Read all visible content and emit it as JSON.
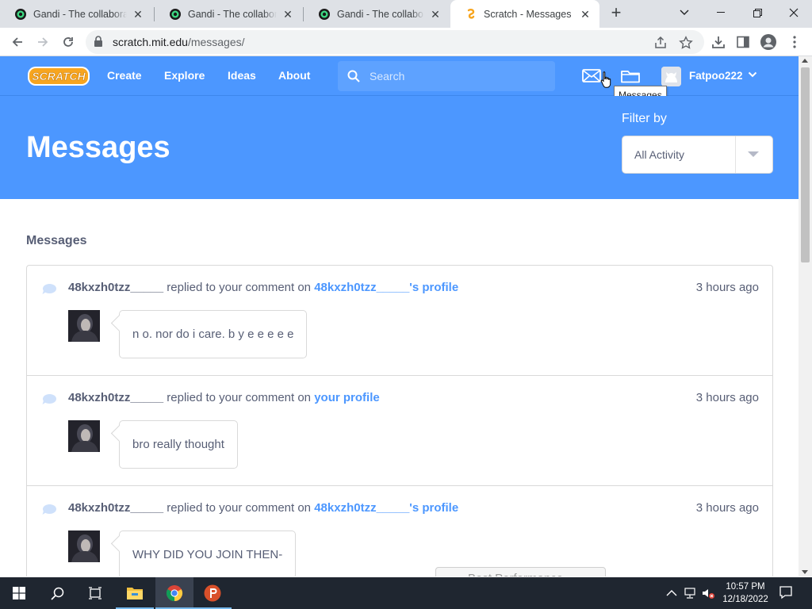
{
  "browser": {
    "tabs": [
      {
        "title": "Gandi - The collaborative",
        "active": false
      },
      {
        "title": "Gandi - The collaborative",
        "active": false
      },
      {
        "title": "Gandi - The collaborative",
        "active": false
      },
      {
        "title": "Scratch - Messages",
        "active": true
      }
    ],
    "url_host": "scratch.mit.edu",
    "url_path": "/messages/"
  },
  "scratch_nav": {
    "links": [
      "Create",
      "Explore",
      "Ideas",
      "About"
    ],
    "search_placeholder": "Search",
    "username": "Fatpoo222",
    "tooltip": "Messages"
  },
  "hero": {
    "title": "Messages",
    "filter_label": "Filter by",
    "filter_value": "All Activity"
  },
  "section_title": "Messages",
  "messages": [
    {
      "user": "48kxzh0tzz_____",
      "action": "replied to your comment on",
      "target": "48kxzh0tzz_____'s profile",
      "time": "3 hours ago",
      "comment": "n o. nor do i care. b y e e e e e"
    },
    {
      "user": "48kxzh0tzz_____",
      "action": "replied to your comment on",
      "target": "your profile",
      "time": "3 hours ago",
      "comment": "bro really thought"
    },
    {
      "user": "48kxzh0tzz_____",
      "action": "replied to your comment on",
      "target": "48kxzh0tzz_____'s profile",
      "time": "3 hours ago",
      "comment": "WHY DID YOU JOIN THEN-"
    }
  ],
  "overlay_banner": "Best Performance",
  "taskbar": {
    "time": "10:57 PM",
    "date": "12/18/2022"
  },
  "colors": {
    "scratch_blue": "#4c97ff",
    "text": "#575e75",
    "taskbar": "#1f2630"
  }
}
